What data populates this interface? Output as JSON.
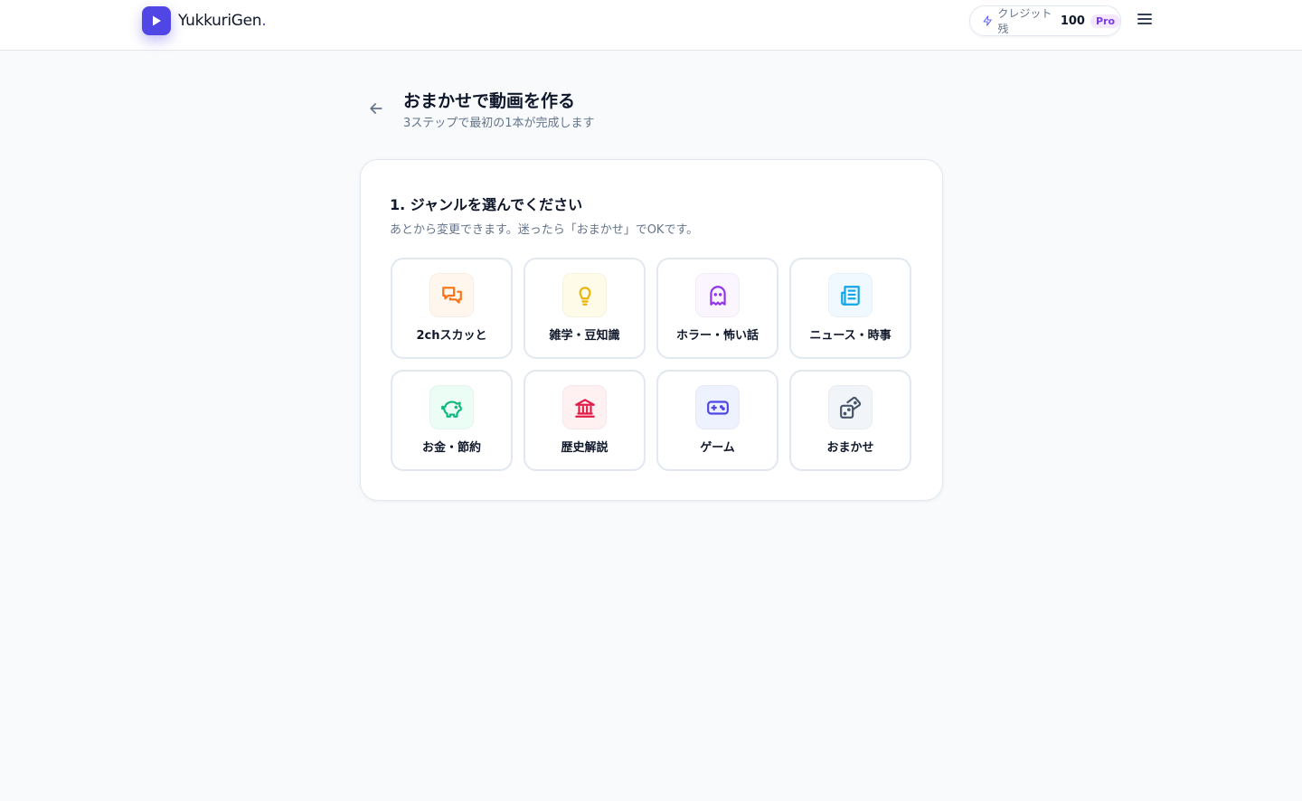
{
  "app": {
    "brand_name": "YukkuriGen",
    "brand_suffix": ".",
    "accent_color": "#4f46e5"
  },
  "header": {
    "credit_label": "クレジット残",
    "credit_value": "100",
    "plan_badge": "Pro",
    "menu_icon": "hamburger-menu-icon"
  },
  "page": {
    "title": "おまかせで動画を作る",
    "subtitle": "3ステップで最初の1本が完成します",
    "back_icon": "arrow-left-icon"
  },
  "step": {
    "title": "1. ジャンルを選んでください",
    "hint": "あとから変更できます。迷ったら「おまかせ」でOKです。"
  },
  "genres": [
    {
      "label": "2chスカッと",
      "icon": "chat-bubbles-icon",
      "color": "#f97316",
      "bg": "#fff7ed"
    },
    {
      "label": "雑学・豆知識",
      "icon": "lightbulb-icon",
      "color": "#eab308",
      "bg": "#fefce8"
    },
    {
      "label": "ホラー・怖い話",
      "icon": "ghost-icon",
      "color": "#9333ea",
      "bg": "#faf5ff"
    },
    {
      "label": "ニュース・時事",
      "icon": "newspaper-icon",
      "color": "#0ea5e9",
      "bg": "#f0f9ff"
    },
    {
      "label": "お金・節約",
      "icon": "piggy-bank-icon",
      "color": "#10b981",
      "bg": "#ecfdf5"
    },
    {
      "label": "歴史解説",
      "icon": "landmark-icon",
      "color": "#e11d48",
      "bg": "#fff1f2"
    },
    {
      "label": "ゲーム",
      "icon": "gamepad-icon",
      "color": "#4f46e5",
      "bg": "#eef2ff"
    },
    {
      "label": "おまかせ",
      "icon": "dice-icon",
      "color": "#475569",
      "bg": "#f1f5f9"
    }
  ]
}
